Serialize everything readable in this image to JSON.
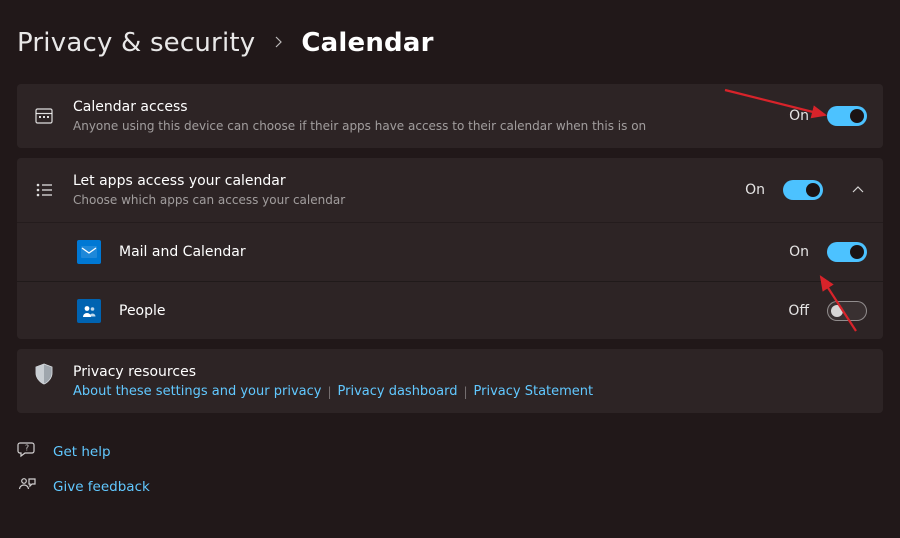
{
  "breadcrumb": {
    "parent": "Privacy & security",
    "current": "Calendar"
  },
  "calendar_access": {
    "title": "Calendar access",
    "subtitle": "Anyone using this device can choose if their apps have access to their calendar when this is on",
    "state_label": "On",
    "toggle": "on"
  },
  "let_apps": {
    "title": "Let apps access your calendar",
    "subtitle": "Choose which apps can access your calendar",
    "state_label": "On",
    "toggle": "on",
    "expanded": true,
    "apps": [
      {
        "icon": "mail-icon",
        "name": "Mail and Calendar",
        "state_label": "On",
        "toggle": "on"
      },
      {
        "icon": "people-icon",
        "name": "People",
        "state_label": "Off",
        "toggle": "off"
      }
    ]
  },
  "resources": {
    "title": "Privacy resources",
    "links": [
      "About these settings and your privacy",
      "Privacy dashboard",
      "Privacy Statement"
    ]
  },
  "footer": {
    "help": "Get help",
    "feedback": "Give feedback"
  }
}
